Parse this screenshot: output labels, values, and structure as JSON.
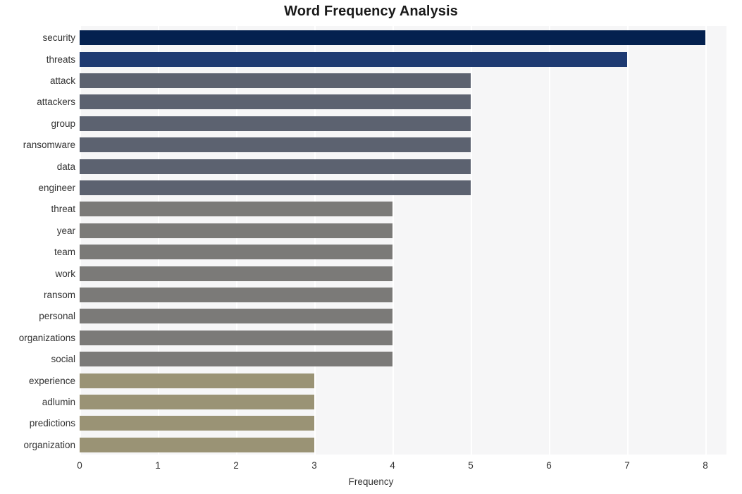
{
  "chart_data": {
    "type": "bar",
    "orientation": "horizontal",
    "title": "Word Frequency Analysis",
    "xlabel": "Frequency",
    "ylabel": "",
    "xlim": [
      0,
      8.27
    ],
    "xticks": [
      0,
      1,
      2,
      3,
      4,
      5,
      6,
      7,
      8
    ],
    "xticklabels": [
      "0",
      "1",
      "2",
      "3",
      "4",
      "5",
      "6",
      "7",
      "8"
    ],
    "grid": "vertical-white-on-light",
    "legend": "none",
    "categories": [
      "security",
      "threats",
      "attack",
      "attackers",
      "group",
      "ransomware",
      "data",
      "engineer",
      "threat",
      "year",
      "team",
      "work",
      "ransom",
      "personal",
      "organizations",
      "social",
      "experience",
      "adlumin",
      "predictions",
      "organization"
    ],
    "values": [
      8,
      7,
      5,
      5,
      5,
      5,
      5,
      5,
      4,
      4,
      4,
      4,
      4,
      4,
      4,
      4,
      3,
      3,
      3,
      3
    ],
    "bar_colors": [
      "#04214f",
      "#1e3a72",
      "#5c6270",
      "#5c6270",
      "#5c6270",
      "#5c6270",
      "#5c6270",
      "#5c6270",
      "#7b7a78",
      "#7b7a78",
      "#7b7a78",
      "#7b7a78",
      "#7b7a78",
      "#7b7a78",
      "#7b7a78",
      "#7b7a78",
      "#9a9375",
      "#9a9375",
      "#9a9375",
      "#9a9375"
    ]
  },
  "style": {
    "plot_background": "#f6f6f7",
    "figure_background": "#ffffff",
    "gridline_color": "#ffffff",
    "tick_label_color": "#333333",
    "title_color": "#1a1a1a"
  }
}
